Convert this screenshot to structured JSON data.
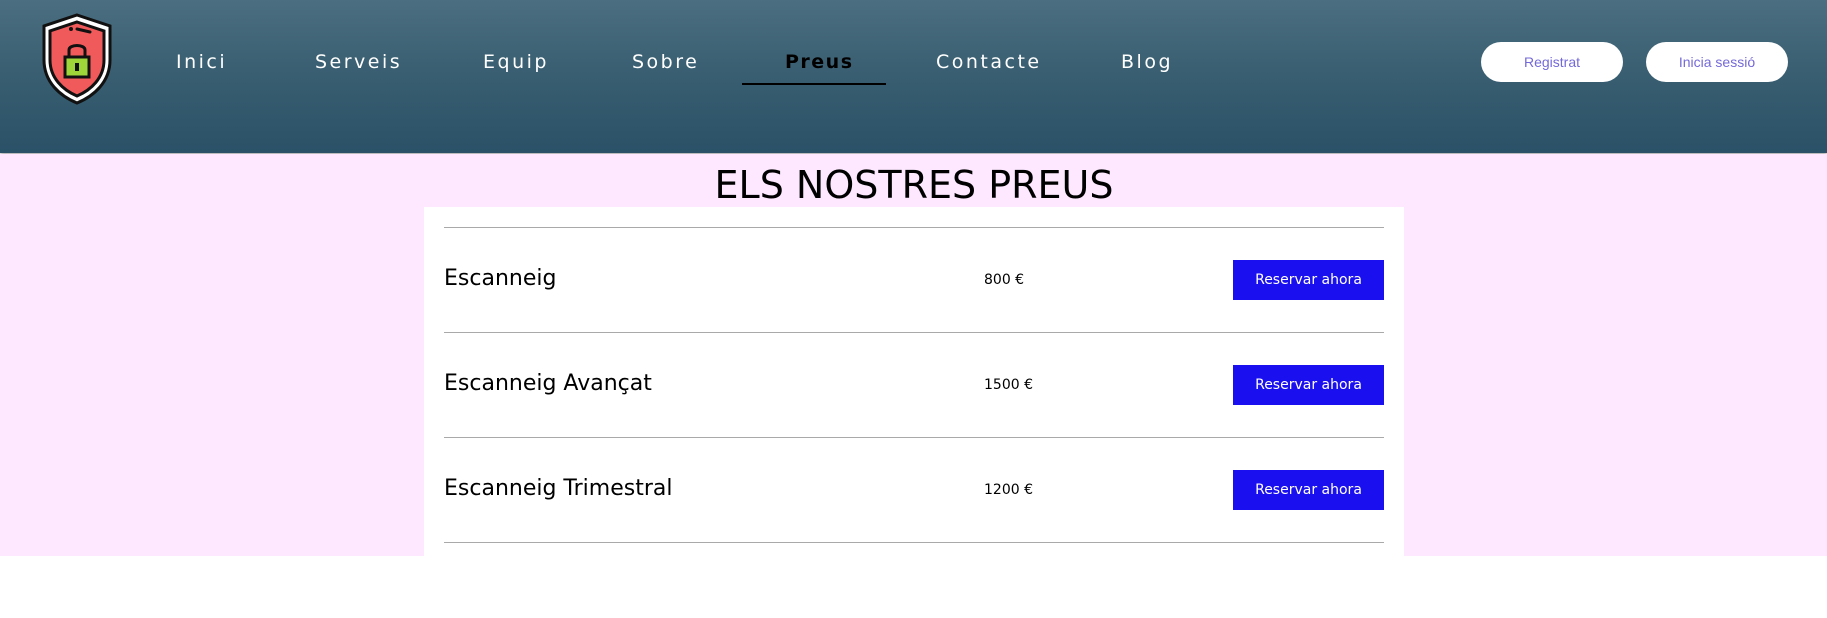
{
  "header": {
    "logo_icon": "shield-lock-icon",
    "nav": [
      {
        "label": "Inici"
      },
      {
        "label": "Serveis"
      },
      {
        "label": "Equip"
      },
      {
        "label": "Sobre"
      },
      {
        "label": "Preus",
        "active": true
      },
      {
        "label": "Contacte"
      },
      {
        "label": "Blog"
      }
    ],
    "signup_label": "Registrat",
    "login_label": "Inicia sessió"
  },
  "main": {
    "title": "ELS NOSTRES PREUS",
    "services": [
      {
        "name": "Escanneig",
        "price": "800 €",
        "button": "Reservar ahora"
      },
      {
        "name": "Escanneig Avançat",
        "price": "1500 €",
        "button": "Reservar ahora"
      },
      {
        "name": "Escanneig Trimestral",
        "price": "1200 €",
        "button": "Reservar ahora"
      }
    ]
  },
  "colors": {
    "header_gradient_top": "#4b6f80",
    "header_gradient_bottom": "#2a5167",
    "page_background": "#fde8ff",
    "button_background": "#1a0fef",
    "pill_text": "#7469d8",
    "shield_red": "#f15a5a",
    "lock_green": "#9ed63a"
  }
}
